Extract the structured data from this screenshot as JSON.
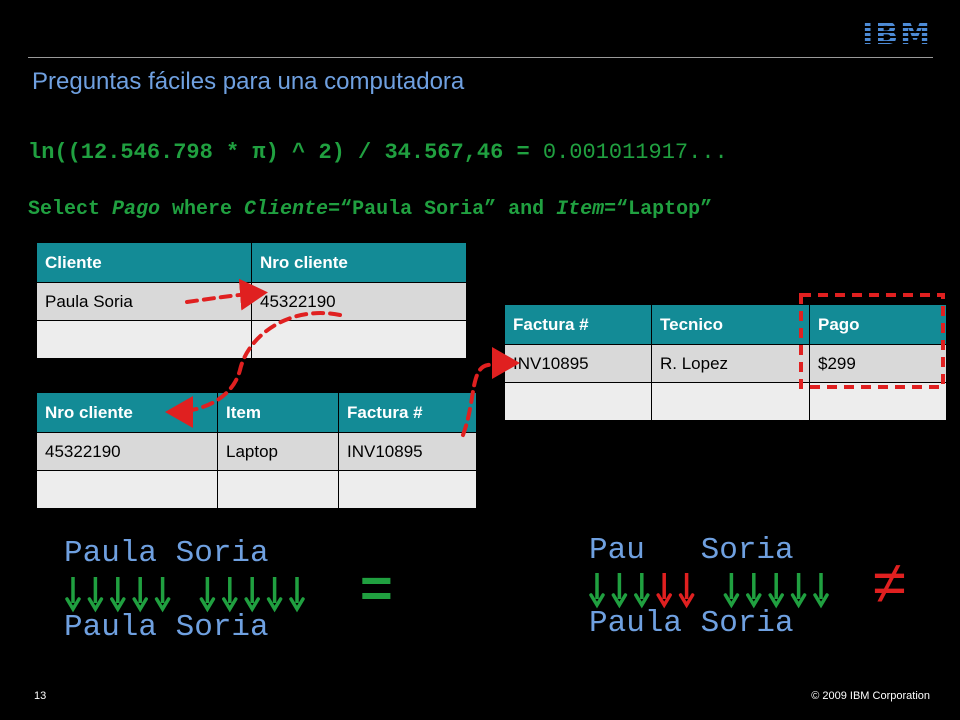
{
  "logo": "IBM",
  "title": "Preguntas fáciles para una computadora",
  "formula": {
    "left": "ln((12.546.798 * π) ^ 2) / 34.567,46 = ",
    "result": "0.001011917..."
  },
  "sql": {
    "select": "Select ",
    "pago": "Pago",
    "where": " where ",
    "cliente": "Cliente",
    "eq1": "=“Paula Soria” and ",
    "item": "Item",
    "eq2": "=“Laptop”"
  },
  "table1": {
    "headers": [
      "Cliente",
      "Nro cliente"
    ],
    "row": [
      "Paula Soria",
      "45322190"
    ]
  },
  "table2": {
    "headers": [
      "Nro cliente",
      "Item",
      "Factura #"
    ],
    "row": [
      "45322190",
      "Laptop",
      "INV10895"
    ]
  },
  "table3": {
    "headers": [
      "Factura #",
      "Tecnico",
      "Pago"
    ],
    "row": [
      "INV10895",
      "R. Lopez",
      "$299"
    ]
  },
  "comparison_left": {
    "top": "Paula Soria",
    "bottom": "Paula Soria",
    "equals": "="
  },
  "comparison_right": {
    "top": "Pau   Soria",
    "bottom": "Paula Soria",
    "not_equals": "≠"
  },
  "colors": {
    "accent_blue": "#6fa0e0",
    "header_teal": "#138b96",
    "match_green": "#20a040",
    "mismatch_red": "#e02020"
  },
  "footer": {
    "page": "13",
    "copyright": "© 2009 IBM Corporation"
  }
}
